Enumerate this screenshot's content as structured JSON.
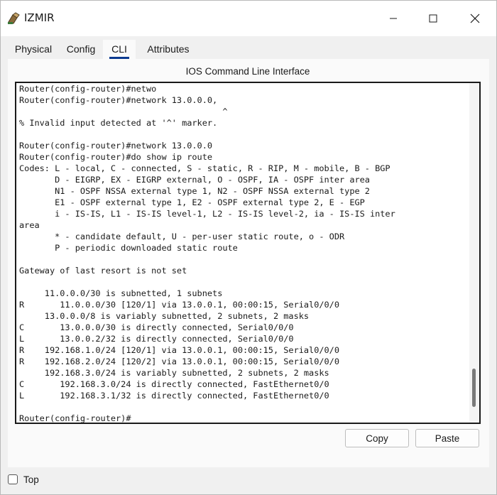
{
  "window": {
    "title": "IZMIR",
    "icon": "router-device-icon"
  },
  "tabs": [
    {
      "label": "Physical",
      "active": false
    },
    {
      "label": "Config",
      "active": false
    },
    {
      "label": "CLI",
      "active": true
    },
    {
      "label": "Attributes",
      "active": false
    }
  ],
  "cli": {
    "heading": "IOS Command Line Interface",
    "lines": [
      "Router(config-router)#netwo",
      "Router(config-router)#network 13.0.0.0,",
      "                                        ^",
      "% Invalid input detected at '^' marker.",
      "",
      "Router(config-router)#network 13.0.0.0",
      "Router(config-router)#do show ip route",
      "Codes: L - local, C - connected, S - static, R - RIP, M - mobile, B - BGP",
      "       D - EIGRP, EX - EIGRP external, O - OSPF, IA - OSPF inter area",
      "       N1 - OSPF NSSA external type 1, N2 - OSPF NSSA external type 2",
      "       E1 - OSPF external type 1, E2 - OSPF external type 2, E - EGP",
      "       i - IS-IS, L1 - IS-IS level-1, L2 - IS-IS level-2, ia - IS-IS inter",
      "area",
      "       * - candidate default, U - per-user static route, o - ODR",
      "       P - periodic downloaded static route",
      "",
      "Gateway of last resort is not set",
      "",
      "     11.0.0.0/30 is subnetted, 1 subnets",
      "R       11.0.0.0/30 [120/1] via 13.0.0.1, 00:00:15, Serial0/0/0",
      "     13.0.0.0/8 is variably subnetted, 2 subnets, 2 masks",
      "C       13.0.0.0/30 is directly connected, Serial0/0/0",
      "L       13.0.0.2/32 is directly connected, Serial0/0/0",
      "R    192.168.1.0/24 [120/1] via 13.0.0.1, 00:00:15, Serial0/0/0",
      "R    192.168.2.0/24 [120/2] via 13.0.0.1, 00:00:15, Serial0/0/0",
      "     192.168.3.0/24 is variably subnetted, 2 subnets, 2 masks",
      "C       192.168.3.0/24 is directly connected, FastEthernet0/0",
      "L       192.168.3.1/32 is directly connected, FastEthernet0/0",
      "",
      "Router(config-router)#"
    ]
  },
  "buttons": {
    "copy_label": "Copy",
    "paste_label": "Paste"
  },
  "footer": {
    "top_label": "Top",
    "top_checked": false
  }
}
